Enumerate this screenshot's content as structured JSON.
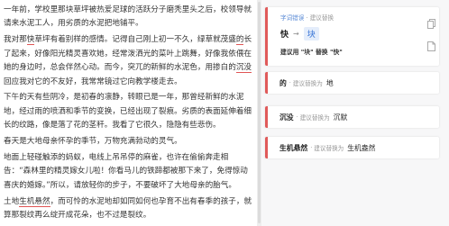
{
  "editor": {
    "paragraphs": [
      {
        "segments": [
          {
            "text": "一年前，学校里那块草坪被热爱足球的活跃分子磨秃里头之后，校领导就请来水泥工人，用劣质的水泥把地铺平。"
          }
        ]
      },
      {
        "segments": [
          {
            "text": "我对那"
          },
          {
            "text": "快",
            "mark": true
          },
          {
            "text": "草坪有着别样的感情。记得自己刚上初一不久，绿草就茂盛"
          },
          {
            "text": "的",
            "mark": true
          },
          {
            "text": "长了起来，好像阳光精灵喜欢她，经常泼洒光的菜叶上跳舞，好像我依偎在她的身边时，总会伴然心动。而今，突兀的新鲜的水泥色，用掺白的"
          },
          {
            "text": "沉没",
            "mark": true
          },
          {
            "text": "回应我对它的不友好，我常常镜过它向教学楼走去。"
          }
        ]
      },
      {
        "segments": [
          {
            "text": "下午的天有些阴冷，是初春的凛静，转眼已是一年，那曾经新鲜的水泥地，经过雨的喷洒和季节的变换，已经出现了裂痕。劣质的表面延伸着细长的纹路，像是落了花的茎秆。我看了它很久，隐隐有些悲伤。"
          }
        ]
      },
      {
        "segments": [
          {
            "text": "春天是大地母亲怀孕的季节，万物充满勃动的灵气。"
          }
        ]
      },
      {
        "segments": [
          {
            "text": "地面上轻碰触添的蚂蚁，电线上吊吊停的麻雀，也许在偷偷奔走相告：“森林里的精灵嫁女儿啦！你看马儿的铁蹄都被那下来了，免得惊动喜庆的婚嫁。”所以，请放轻你的步子，不要破坏了大地母亲的胎气。"
          }
        ]
      },
      {
        "segments": [
          {
            "text": "土地"
          },
          {
            "text": "生机悬然",
            "mark": true
          },
          {
            "text": "，而可怜的水泥地却如同如何也孕育不出有春季的孩子，就算那裂纹再么绽开成花朵，也不过是裂纹。"
          }
        ]
      }
    ]
  },
  "panel": {
    "expanded": {
      "type_label": "字词错误",
      "action_label": "建议替换",
      "original": "快",
      "suggestion": "块",
      "note": "建议用 \"块\" 替换 \"快\""
    },
    "cards": [
      {
        "original": "的",
        "separator": "·",
        "kind": "建议替换为",
        "suggestion": "地"
      },
      {
        "original": "沉没",
        "separator": "·",
        "kind": "建议替换为",
        "suggestion": "沉默"
      },
      {
        "original": "生机悬然",
        "separator": "·",
        "kind": "建议替换为",
        "suggestion": "生机盎然"
      }
    ],
    "arrow": "→",
    "icons": [
      "copy-icon",
      "document-icon"
    ]
  },
  "colors": {
    "accent_red": "#e05a5a",
    "suggestion_blue": "#3673d6",
    "panel_bg": "#f7f7f8"
  }
}
